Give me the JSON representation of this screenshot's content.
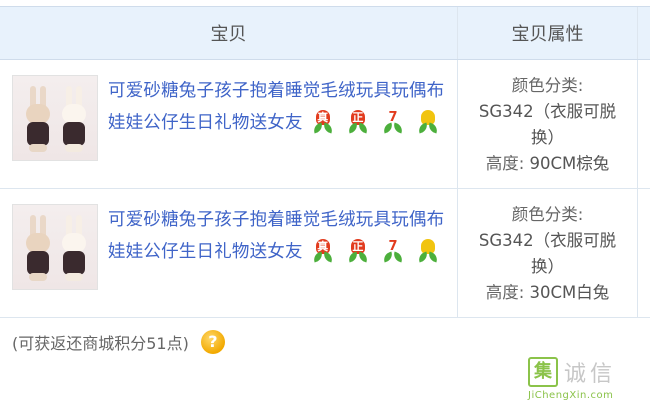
{
  "header": {
    "col_item": "宝贝",
    "col_attrs": "宝贝属性"
  },
  "items": [
    {
      "title": "可爱砂糖兔子孩子抱着睡觉毛绒玩具玩偶布娃娃公仔生日礼物送女友",
      "badges": [
        "真",
        "正",
        "7",
        ""
      ],
      "attr_color_label": "颜色分类:",
      "attr_color_value": "SG342（衣服可脱换）",
      "attr_height_label": "高度:",
      "attr_height_value": "90CM棕兔"
    },
    {
      "title": "可爱砂糖兔子孩子抱着睡觉毛绒玩具玩偶布娃娃公仔生日礼物送女友",
      "badges": [
        "真",
        "正",
        "7",
        ""
      ],
      "attr_color_label": "颜色分类:",
      "attr_color_value": "SG342（衣服可脱换）",
      "attr_height_label": "高度:",
      "attr_height_value": "30CM白兔"
    }
  ],
  "footer": {
    "points_text": "(可获返还商城积分51点)",
    "help_icon": "?"
  },
  "watermark": {
    "logo_char": "集",
    "text": "诚信",
    "url": "JiChengXin.com"
  },
  "colors": {
    "link": "#3f64c8",
    "header_bg": "#e8f2fc",
    "watermark_green": "#8bc34a"
  }
}
